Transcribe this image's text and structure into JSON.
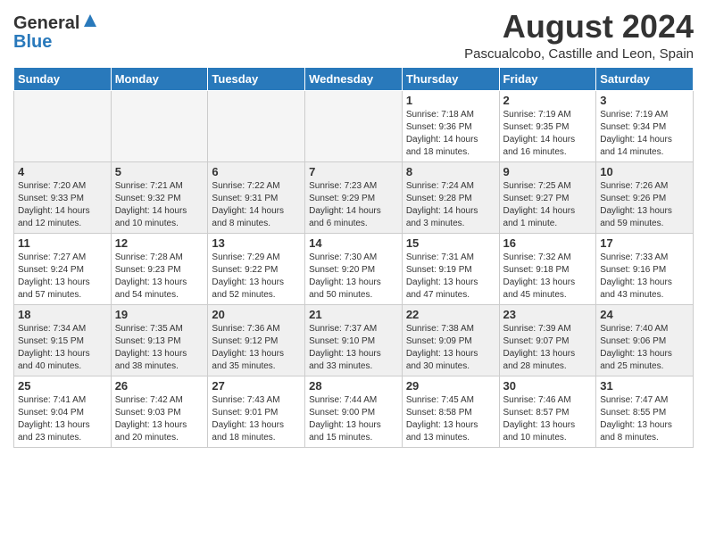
{
  "logo": {
    "general": "General",
    "blue": "Blue"
  },
  "title": "August 2024",
  "subtitle": "Pascualcobo, Castille and Leon, Spain",
  "headers": [
    "Sunday",
    "Monday",
    "Tuesday",
    "Wednesday",
    "Thursday",
    "Friday",
    "Saturday"
  ],
  "weeks": [
    [
      {
        "day": "",
        "info": ""
      },
      {
        "day": "",
        "info": ""
      },
      {
        "day": "",
        "info": ""
      },
      {
        "day": "",
        "info": ""
      },
      {
        "day": "1",
        "info": "Sunrise: 7:18 AM\nSunset: 9:36 PM\nDaylight: 14 hours and 18 minutes."
      },
      {
        "day": "2",
        "info": "Sunrise: 7:19 AM\nSunset: 9:35 PM\nDaylight: 14 hours and 16 minutes."
      },
      {
        "day": "3",
        "info": "Sunrise: 7:19 AM\nSunset: 9:34 PM\nDaylight: 14 hours and 14 minutes."
      }
    ],
    [
      {
        "day": "4",
        "info": "Sunrise: 7:20 AM\nSunset: 9:33 PM\nDaylight: 14 hours and 12 minutes."
      },
      {
        "day": "5",
        "info": "Sunrise: 7:21 AM\nSunset: 9:32 PM\nDaylight: 14 hours and 10 minutes."
      },
      {
        "day": "6",
        "info": "Sunrise: 7:22 AM\nSunset: 9:31 PM\nDaylight: 14 hours and 8 minutes."
      },
      {
        "day": "7",
        "info": "Sunrise: 7:23 AM\nSunset: 9:29 PM\nDaylight: 14 hours and 6 minutes."
      },
      {
        "day": "8",
        "info": "Sunrise: 7:24 AM\nSunset: 9:28 PM\nDaylight: 14 hours and 3 minutes."
      },
      {
        "day": "9",
        "info": "Sunrise: 7:25 AM\nSunset: 9:27 PM\nDaylight: 14 hours and 1 minute."
      },
      {
        "day": "10",
        "info": "Sunrise: 7:26 AM\nSunset: 9:26 PM\nDaylight: 13 hours and 59 minutes."
      }
    ],
    [
      {
        "day": "11",
        "info": "Sunrise: 7:27 AM\nSunset: 9:24 PM\nDaylight: 13 hours and 57 minutes."
      },
      {
        "day": "12",
        "info": "Sunrise: 7:28 AM\nSunset: 9:23 PM\nDaylight: 13 hours and 54 minutes."
      },
      {
        "day": "13",
        "info": "Sunrise: 7:29 AM\nSunset: 9:22 PM\nDaylight: 13 hours and 52 minutes."
      },
      {
        "day": "14",
        "info": "Sunrise: 7:30 AM\nSunset: 9:20 PM\nDaylight: 13 hours and 50 minutes."
      },
      {
        "day": "15",
        "info": "Sunrise: 7:31 AM\nSunset: 9:19 PM\nDaylight: 13 hours and 47 minutes."
      },
      {
        "day": "16",
        "info": "Sunrise: 7:32 AM\nSunset: 9:18 PM\nDaylight: 13 hours and 45 minutes."
      },
      {
        "day": "17",
        "info": "Sunrise: 7:33 AM\nSunset: 9:16 PM\nDaylight: 13 hours and 43 minutes."
      }
    ],
    [
      {
        "day": "18",
        "info": "Sunrise: 7:34 AM\nSunset: 9:15 PM\nDaylight: 13 hours and 40 minutes."
      },
      {
        "day": "19",
        "info": "Sunrise: 7:35 AM\nSunset: 9:13 PM\nDaylight: 13 hours and 38 minutes."
      },
      {
        "day": "20",
        "info": "Sunrise: 7:36 AM\nSunset: 9:12 PM\nDaylight: 13 hours and 35 minutes."
      },
      {
        "day": "21",
        "info": "Sunrise: 7:37 AM\nSunset: 9:10 PM\nDaylight: 13 hours and 33 minutes."
      },
      {
        "day": "22",
        "info": "Sunrise: 7:38 AM\nSunset: 9:09 PM\nDaylight: 13 hours and 30 minutes."
      },
      {
        "day": "23",
        "info": "Sunrise: 7:39 AM\nSunset: 9:07 PM\nDaylight: 13 hours and 28 minutes."
      },
      {
        "day": "24",
        "info": "Sunrise: 7:40 AM\nSunset: 9:06 PM\nDaylight: 13 hours and 25 minutes."
      }
    ],
    [
      {
        "day": "25",
        "info": "Sunrise: 7:41 AM\nSunset: 9:04 PM\nDaylight: 13 hours and 23 minutes."
      },
      {
        "day": "26",
        "info": "Sunrise: 7:42 AM\nSunset: 9:03 PM\nDaylight: 13 hours and 20 minutes."
      },
      {
        "day": "27",
        "info": "Sunrise: 7:43 AM\nSunset: 9:01 PM\nDaylight: 13 hours and 18 minutes."
      },
      {
        "day": "28",
        "info": "Sunrise: 7:44 AM\nSunset: 9:00 PM\nDaylight: 13 hours and 15 minutes."
      },
      {
        "day": "29",
        "info": "Sunrise: 7:45 AM\nSunset: 8:58 PM\nDaylight: 13 hours and 13 minutes."
      },
      {
        "day": "30",
        "info": "Sunrise: 7:46 AM\nSunset: 8:57 PM\nDaylight: 13 hours and 10 minutes."
      },
      {
        "day": "31",
        "info": "Sunrise: 7:47 AM\nSunset: 8:55 PM\nDaylight: 13 hours and 8 minutes."
      }
    ]
  ]
}
